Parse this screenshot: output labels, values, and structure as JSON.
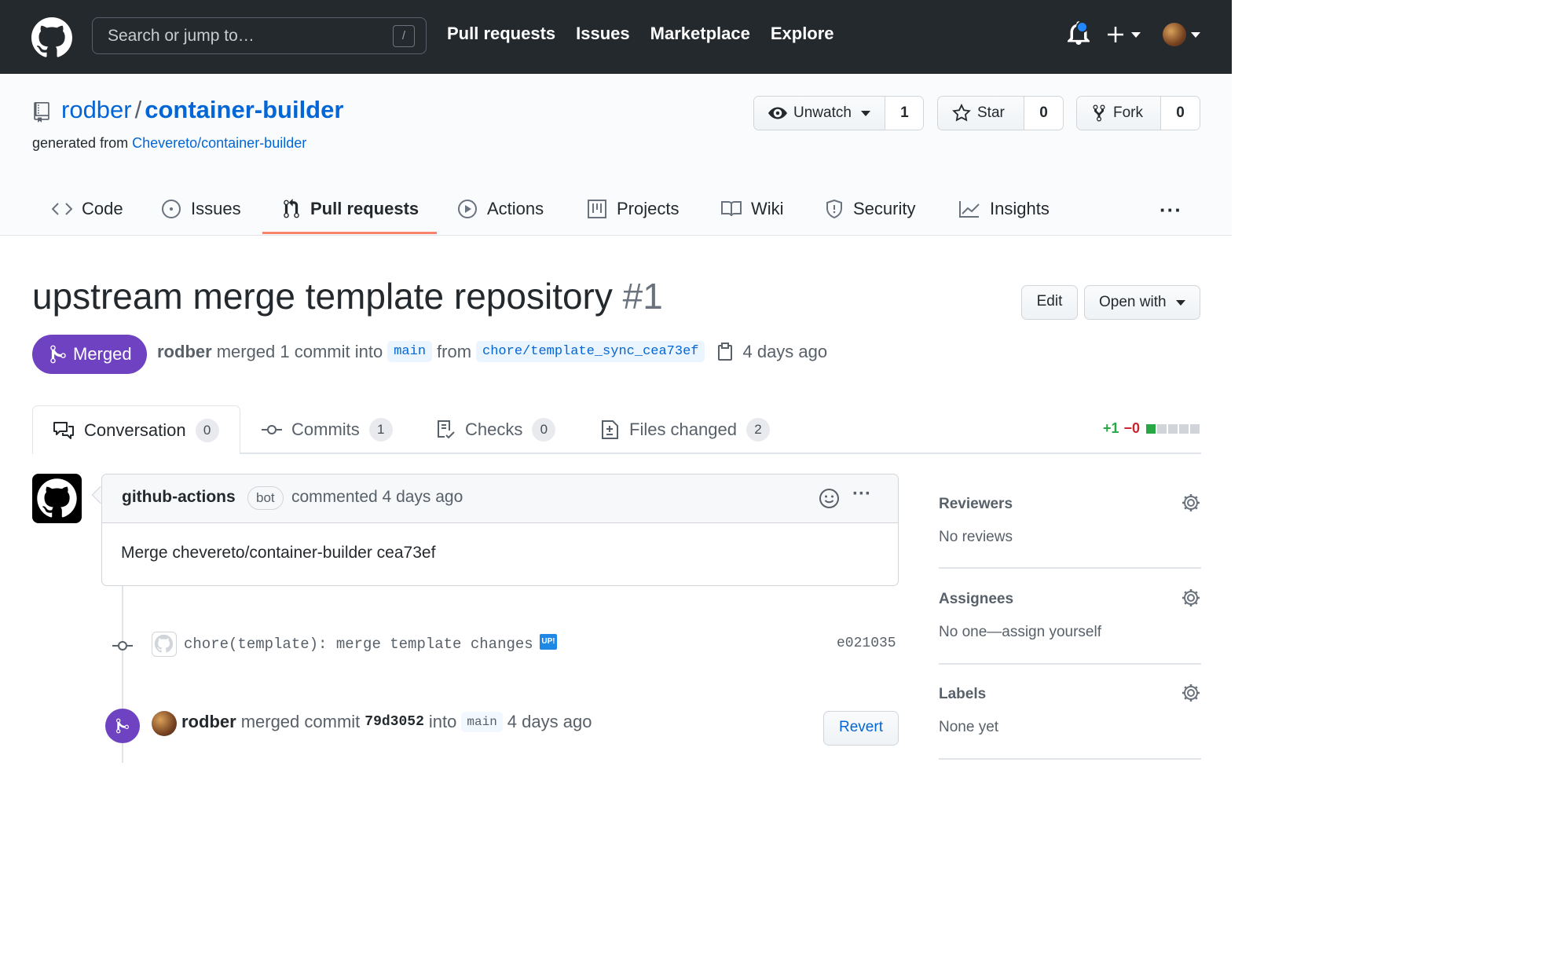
{
  "topbar": {
    "search_placeholder": "Search or jump to…",
    "search_shortcut": "/",
    "nav": [
      "Pull requests",
      "Issues",
      "Marketplace",
      "Explore"
    ]
  },
  "repo": {
    "owner": "rodber",
    "separator": "/",
    "name": "container-builder",
    "generated_prefix": "generated from",
    "generated_from": "Chevereto/container-builder",
    "watch_label": "Unwatch",
    "watch_count": "1",
    "star_label": "Star",
    "star_count": "0",
    "fork_label": "Fork",
    "fork_count": "0"
  },
  "reponav": {
    "items": [
      {
        "label": "Code"
      },
      {
        "label": "Issues"
      },
      {
        "label": "Pull requests"
      },
      {
        "label": "Actions"
      },
      {
        "label": "Projects"
      },
      {
        "label": "Wiki"
      },
      {
        "label": "Security"
      },
      {
        "label": "Insights"
      }
    ],
    "more": "···"
  },
  "pr": {
    "title": "upstream merge template repository",
    "number": "#1",
    "edit_label": "Edit",
    "open_with_label": "Open with",
    "state": "Merged",
    "author": "rodber",
    "merged_text": "merged 1 commit into",
    "base_branch": "main",
    "from_text": "from",
    "head_branch": "chore/template_sync_cea73ef",
    "time": "4 days ago"
  },
  "tabs": [
    {
      "label": "Conversation",
      "count": "0"
    },
    {
      "label": "Commits",
      "count": "1"
    },
    {
      "label": "Checks",
      "count": "0"
    },
    {
      "label": "Files changed",
      "count": "2"
    }
  ],
  "diffstat": {
    "additions": "+1",
    "deletions": "−0"
  },
  "comment": {
    "author": "github-actions",
    "badge": "bot",
    "action": "commented 4 days ago",
    "body": "Merge chevereto/container-builder cea73ef"
  },
  "commit": {
    "message": "chore(template): merge template changes",
    "badge": "UP!",
    "sha": "e021035"
  },
  "merge_event": {
    "actor": "rodber",
    "text": "merged commit",
    "sha": "79d3052",
    "into": "into",
    "branch": "main",
    "time": "4 days ago",
    "revert_label": "Revert"
  },
  "sidebar": {
    "reviewers_title": "Reviewers",
    "reviewers_value": "No reviews",
    "assignees_title": "Assignees",
    "assignees_value": "No one—assign yourself",
    "labels_title": "Labels",
    "labels_value": "None yet"
  },
  "colors": {
    "header_bg": "#24292e",
    "link": "#0366d6",
    "merged": "#6f42c1",
    "tab_underline": "#f9826c",
    "addition": "#28a745",
    "deletion": "#cb2431"
  }
}
